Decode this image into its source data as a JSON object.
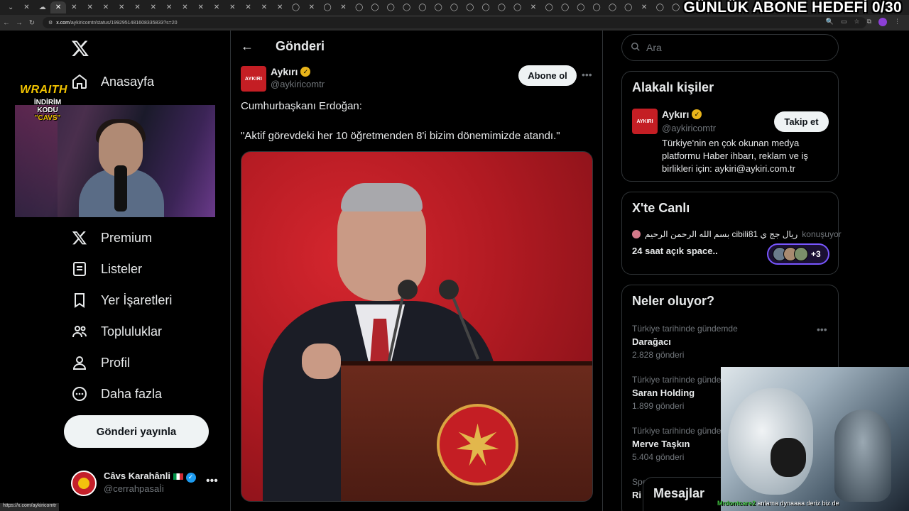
{
  "browser": {
    "url_host": "x.com",
    "url_path": "/aykiricomtr/status/1992951481608335833?s=20",
    "status_url": "https://x.com/aykiricomtr"
  },
  "stream_overlay": {
    "goal_text": "GÜNLÜK ABONE HEDEFİ 0/30",
    "sponsor_brand": "WRAITH",
    "sponsor_code_label": "İNDİRİM KODU",
    "sponsor_code": "\"CAVS\"",
    "chat_user": "Mrdontcare2",
    "chat_message": "anlama dynaaaa deriz biz de"
  },
  "sidebar": {
    "items": [
      {
        "label": "Anasayfa",
        "icon": "home-icon"
      },
      {
        "label": "Premium",
        "icon": "x-premium-icon"
      },
      {
        "label": "Listeler",
        "icon": "list-icon"
      },
      {
        "label": "Yer İşaretleri",
        "icon": "bookmark-icon"
      },
      {
        "label": "Topluluklar",
        "icon": "communities-icon"
      },
      {
        "label": "Profil",
        "icon": "profile-icon"
      },
      {
        "label": "Daha fazla",
        "icon": "more-circle-icon"
      }
    ],
    "post_button": "Gönderi yayınla",
    "account": {
      "name": "Câvs Karahânli",
      "handle": "@cerrahpasaİi"
    }
  },
  "main": {
    "title": "Gönderi",
    "post": {
      "avatar_text": "AYKIRI",
      "author": "Aykırı",
      "handle": "@aykiricomtr",
      "subscribe": "Abone ol",
      "text_line1": "Cumhurbaşkanı Erdoğan:",
      "text_line2": "\"Aktif görevdeki her 10 öğretmenden 8'i bizim dönemimizde atandı.\""
    }
  },
  "right": {
    "search_placeholder": "Ara",
    "related": {
      "title": "Alakalı kişiler",
      "avatar_text": "AYKIRI",
      "name": "Aykırı",
      "handle": "@aykiricomtr",
      "follow": "Takip et",
      "bio": "Türkiye'nin en çok okunan medya platformu Haber ihbarı, reklam ve iş birlikleri için: aykiri@aykiri.com.tr"
    },
    "live": {
      "title": "X'te Canlı",
      "host": "بسم الله الرحمن الرحيم cibili81 ریال جج ي",
      "speaking": "konuşuyor",
      "space_title": "24 saat açık space..",
      "more_count": "+3"
    },
    "trends": {
      "title": "Neler oluyor?",
      "items": [
        {
          "category": "Türkiye tarihinde gündemde",
          "name": "Darağacı",
          "count": "2.828 gönderi"
        },
        {
          "category": "Türkiye tarihinde gündem",
          "name": "Saran Holding",
          "count": "1.899 gönderi"
        },
        {
          "category": "Türkiye tarihinde gündem",
          "name": "Merve Taşkın",
          "count": "5.404 gönderi"
        },
        {
          "category": "Spo",
          "name": "Ri",
          "count": ""
        }
      ]
    },
    "messages": "Mesajlar"
  }
}
